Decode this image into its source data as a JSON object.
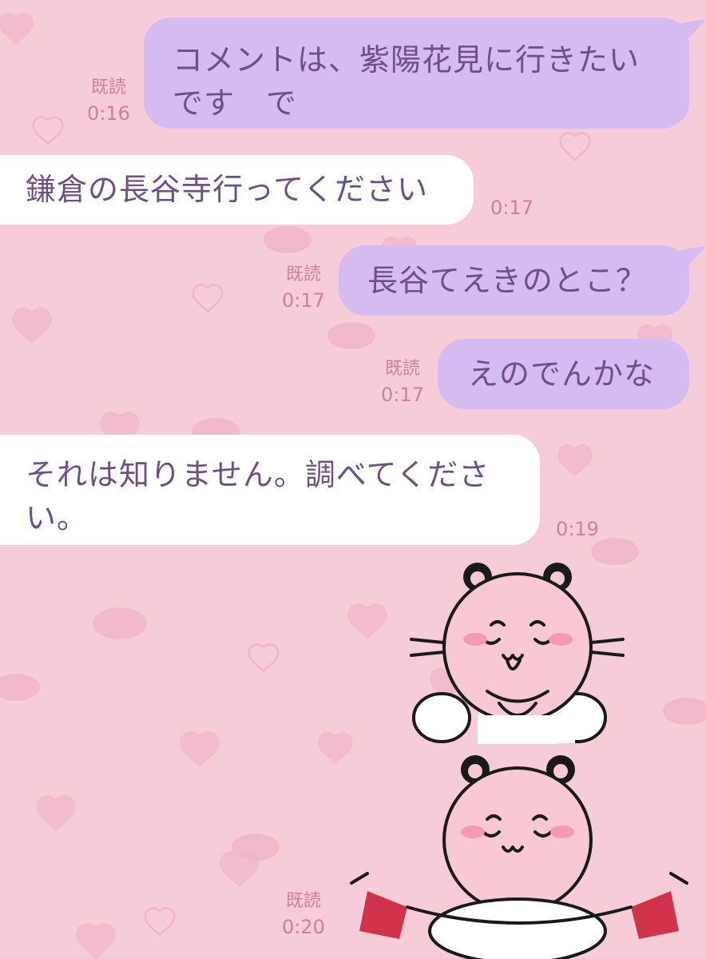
{
  "chat": {
    "messages": [
      {
        "side": "sent",
        "text": "コメントは、紫陽花見に行きたいです　で",
        "read": "既読",
        "time": "0:16"
      },
      {
        "side": "received",
        "text": "鎌倉の長谷寺行ってください",
        "time": "0:17"
      },
      {
        "side": "sent",
        "text": "長谷てえきのとこ？",
        "read": "既読",
        "time": "0:17"
      },
      {
        "side": "sent",
        "text": "えのでんかな",
        "read": "既読",
        "time": "0:17"
      },
      {
        "side": "received",
        "text": "それは知りません。調べてください。",
        "time": "0:19"
      },
      {
        "side": "sent",
        "sticker": "pink-hamster-sticker",
        "read": "既読",
        "time": "0:20"
      }
    ]
  },
  "colors": {
    "background": "#f7ccd9",
    "pattern": "#efb5c8",
    "sent_bubble": "#d5bbef",
    "received_bubble": "#ffffff",
    "bubble_text": "#6f4f86",
    "meta_text": "#d07f9a"
  }
}
